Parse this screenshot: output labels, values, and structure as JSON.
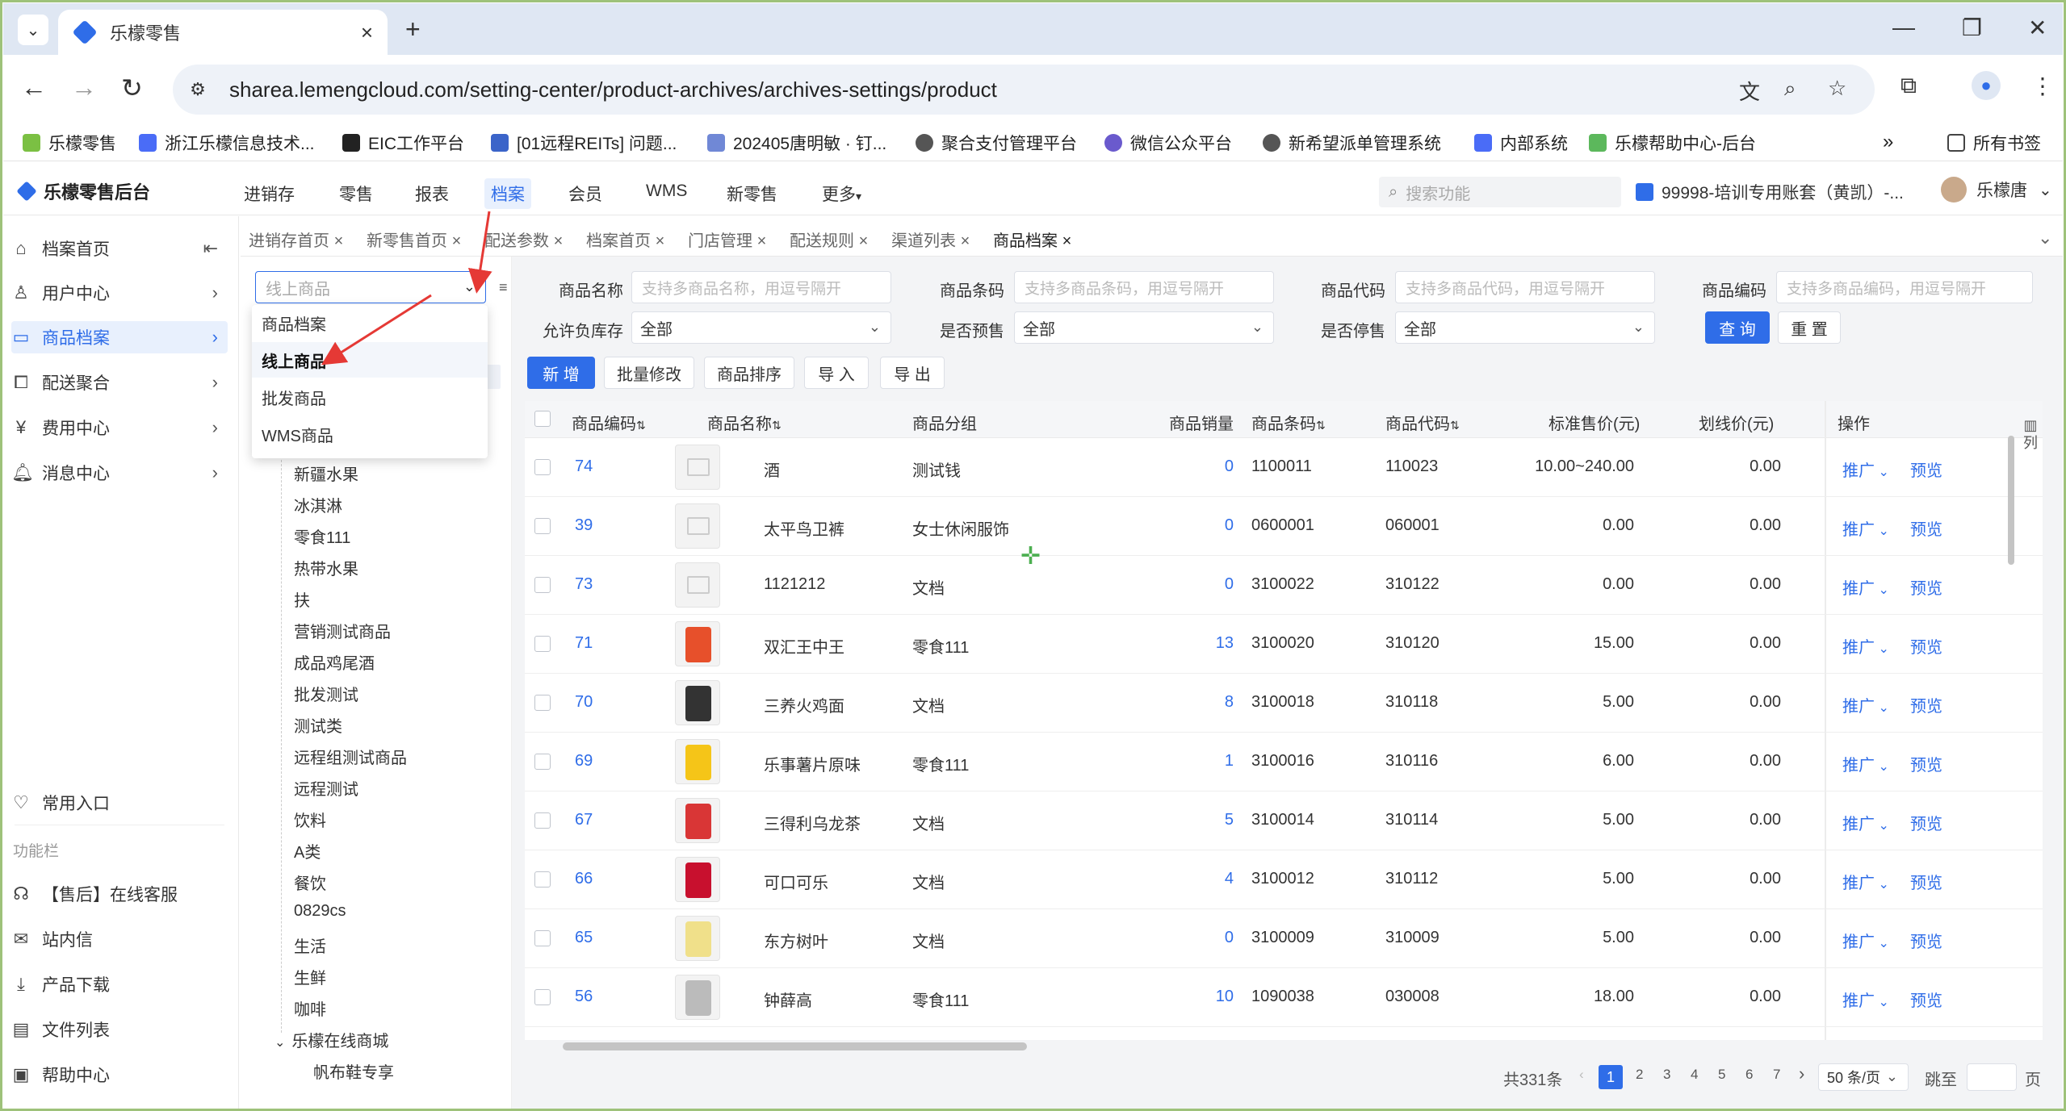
{
  "browser": {
    "tab_title": "乐檬零售",
    "url": "sharea.lemengcloud.com/setting-center/product-archives/archives-settings/product",
    "bookmarks": [
      "乐檬零售",
      "浙江乐檬信息技术...",
      "EIC工作平台",
      "[01远程REITs] 问题...",
      "202405唐明敏 · 钉...",
      "聚合支付管理平台",
      "微信公众平台",
      "新希望派单管理系统",
      "内部系统",
      "乐檬帮助中心-后台"
    ],
    "all_bookmarks": "所有书签"
  },
  "app": {
    "logo": "乐檬零售后台",
    "nav": [
      "进销存",
      "零售",
      "报表",
      "档案",
      "会员",
      "WMS",
      "新零售",
      "更多"
    ],
    "search_placeholder": "搜索功能",
    "account": "99998-培训专用账套（黄凯）-...",
    "user": "乐檬唐"
  },
  "sidebar": {
    "items": [
      "档案首页",
      "用户中心",
      "商品档案",
      "配送聚合",
      "费用中心",
      "消息中心"
    ],
    "common": "常用入口",
    "section": "功能栏",
    "tools": [
      "【售后】在线客服",
      "站内信",
      "产品下载",
      "文件列表",
      "帮助中心"
    ]
  },
  "page_tabs": [
    "进销存首页",
    "新零售首页",
    "配送参数",
    "档案首页",
    "门店管理",
    "配送规则",
    "渠道列表",
    "商品档案"
  ],
  "category": {
    "select_placeholder": "线上商品",
    "options": [
      "商品档案",
      "线上商品",
      "批发商品",
      "WMS商品"
    ],
    "tree": [
      "新疆水果",
      "冰淇淋",
      "零食111",
      "热带水果",
      "扶",
      "营销测试商品",
      "成品鸡尾酒",
      "批发测试",
      "测试类",
      "远程组测试商品",
      "远程测试",
      "饮料",
      "A类",
      "餐饮",
      "0829cs",
      "生活",
      "生鲜",
      "咖啡",
      "乐檬在线商城",
      "帆布鞋专享"
    ]
  },
  "filters": {
    "name_label": "商品名称",
    "name_ph": "支持多商品名称，用逗号隔开",
    "barcode_label": "商品条码",
    "barcode_ph": "支持多商品条码，用逗号隔开",
    "code_label": "商品代码",
    "code_ph": "支持多商品代码，用逗号隔开",
    "num_label": "商品编码",
    "num_ph": "支持多商品编码，用逗号隔开",
    "neg_label": "允许负库存",
    "neg_val": "全部",
    "pre_label": "是否预售",
    "pre_val": "全部",
    "stop_label": "是否停售",
    "stop_val": "全部",
    "query": "查 询",
    "reset": "重 置"
  },
  "actions": [
    "新 增",
    "批量修改",
    "商品排序",
    "导 入",
    "导 出"
  ],
  "table": {
    "headers": [
      "商品编码",
      "商品名称",
      "商品分组",
      "商品销量",
      "商品条码",
      "商品代码",
      "标准售价(元)",
      "划线价(元)",
      "操作"
    ],
    "side_col": "列",
    "promote": "推广",
    "preview": "预览",
    "rows": [
      {
        "id": "74",
        "name": "酒",
        "group": "测试钱",
        "sales": "0",
        "barcode": "1100011",
        "code": "110023",
        "price": "10.00~240.00",
        "strike": "0.00"
      },
      {
        "id": "39",
        "name": "太平鸟卫裤",
        "group": "女士休闲服饰",
        "sales": "0",
        "barcode": "0600001",
        "code": "060001",
        "price": "0.00",
        "strike": "0.00"
      },
      {
        "id": "73",
        "name": "1121212",
        "group": "文档",
        "sales": "0",
        "barcode": "3100022",
        "code": "310122",
        "price": "0.00",
        "strike": "0.00"
      },
      {
        "id": "71",
        "name": "双汇王中王",
        "group": "零食111",
        "sales": "13",
        "barcode": "3100020",
        "code": "310120",
        "price": "15.00",
        "strike": "0.00"
      },
      {
        "id": "70",
        "name": "三养火鸡面",
        "group": "文档",
        "sales": "8",
        "barcode": "3100018",
        "code": "310118",
        "price": "5.00",
        "strike": "0.00"
      },
      {
        "id": "69",
        "name": "乐事薯片原味",
        "group": "零食111",
        "sales": "1",
        "barcode": "3100016",
        "code": "310116",
        "price": "6.00",
        "strike": "0.00"
      },
      {
        "id": "67",
        "name": "三得利乌龙茶",
        "group": "文档",
        "sales": "5",
        "barcode": "3100014",
        "code": "310114",
        "price": "5.00",
        "strike": "0.00"
      },
      {
        "id": "66",
        "name": "可口可乐",
        "group": "文档",
        "sales": "4",
        "barcode": "3100012",
        "code": "310112",
        "price": "5.00",
        "strike": "0.00"
      },
      {
        "id": "65",
        "name": "东方树叶",
        "group": "文档",
        "sales": "0",
        "barcode": "3100009",
        "code": "310009",
        "price": "5.00",
        "strike": "0.00"
      },
      {
        "id": "56",
        "name": "钟薛高",
        "group": "零食111",
        "sales": "10",
        "barcode": "1090038",
        "code": "030008",
        "price": "18.00",
        "strike": "0.00"
      }
    ]
  },
  "pagination": {
    "total": "共331条",
    "pages": [
      "1",
      "2",
      "3",
      "4",
      "5",
      "6",
      "7"
    ],
    "per_page": "50 条/页",
    "jump": "跳至",
    "page_unit": "页"
  }
}
